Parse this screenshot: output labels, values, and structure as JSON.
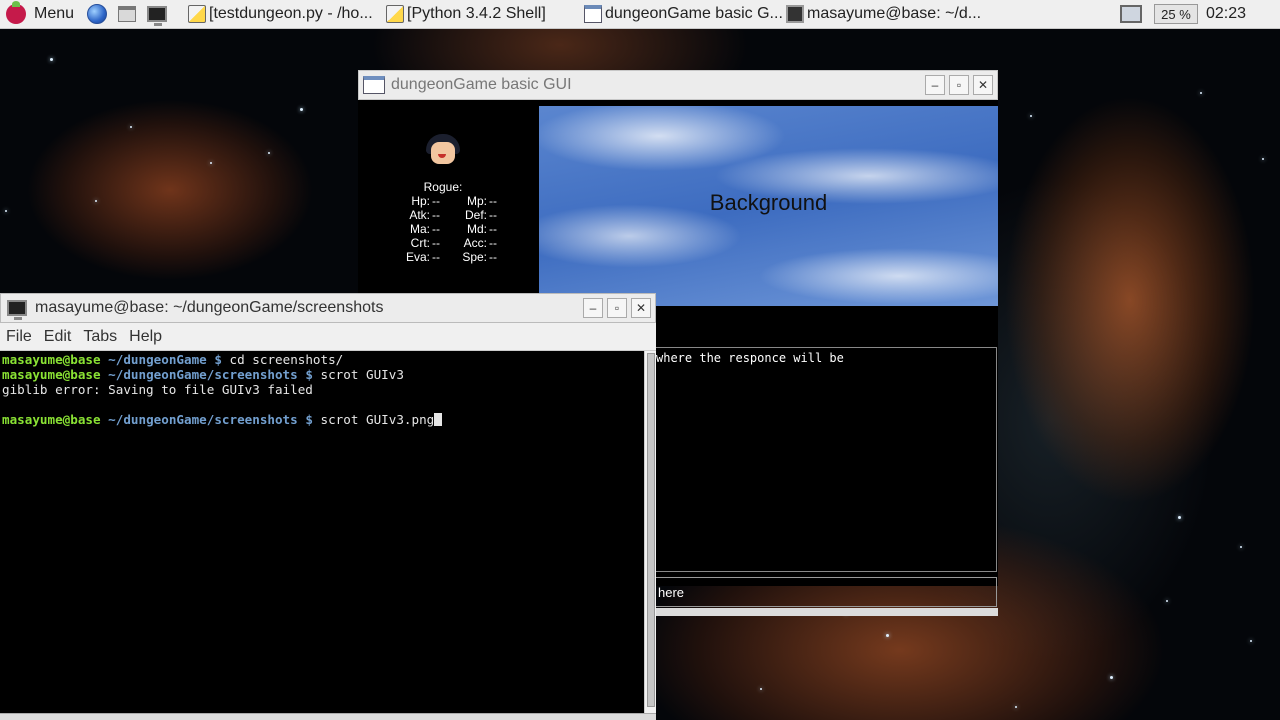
{
  "panel": {
    "menu_label": "Menu",
    "launchers": [
      "web-browser-icon",
      "file-manager-icon",
      "terminal-icon"
    ],
    "tasks": [
      {
        "label": "[testdungeon.py - /ho...",
        "icon": "python-file-icon"
      },
      {
        "label": "[Python 3.4.2 Shell]",
        "icon": "python-file-icon"
      },
      {
        "label": "dungeonGame basic G...",
        "icon": "window-icon"
      },
      {
        "label": "masayume@base: ~/d...",
        "icon": "terminal-icon"
      }
    ],
    "cpu_label": "25 %",
    "clock": "02:23"
  },
  "dungeon_window": {
    "title": "dungeonGame basic GUI",
    "character": {
      "class_label": "Rogue:",
      "stats": [
        [
          {
            "label": "Hp:",
            "value": "--"
          },
          {
            "label": "Mp:",
            "value": "--"
          }
        ],
        [
          {
            "label": "Atk:",
            "value": "--"
          },
          {
            "label": "Def:",
            "value": "--"
          }
        ],
        [
          {
            "label": "Ma:",
            "value": "--"
          },
          {
            "label": "Md:",
            "value": "--"
          }
        ],
        [
          {
            "label": "Crt:",
            "value": "--"
          },
          {
            "label": "Acc:",
            "value": "--"
          }
        ],
        [
          {
            "label": "Eva:",
            "value": "--"
          },
          {
            "label": "Spe:",
            "value": "--"
          }
        ]
      ]
    },
    "background_label": "Background",
    "response_text": "where the responce will be",
    "input_text": "here"
  },
  "terminal_window": {
    "title": "masayume@base: ~/dungeonGame/screenshots",
    "menu": [
      "File",
      "Edit",
      "Tabs",
      "Help"
    ],
    "lines": [
      {
        "user": "masayume@base",
        "path": "~/dungeonGame",
        "prompt": "$",
        "cmd": "cd screenshots/"
      },
      {
        "user": "masayume@base",
        "path": "~/dungeonGame/screenshots",
        "prompt": "$",
        "cmd": "scrot GUIv3"
      },
      {
        "text": "giblib error: Saving to file GUIv3 failed"
      },
      {
        "text": ""
      },
      {
        "user": "masayume@base",
        "path": "~/dungeonGame/screenshots",
        "prompt": "$",
        "cmd": "scrot GUIv3.png",
        "cursor": true
      }
    ]
  },
  "colors": {
    "prompt_user": "#8ae234",
    "prompt_path": "#729fcf",
    "terminal_bg": "#000000",
    "panel_bg": "#efefef"
  }
}
